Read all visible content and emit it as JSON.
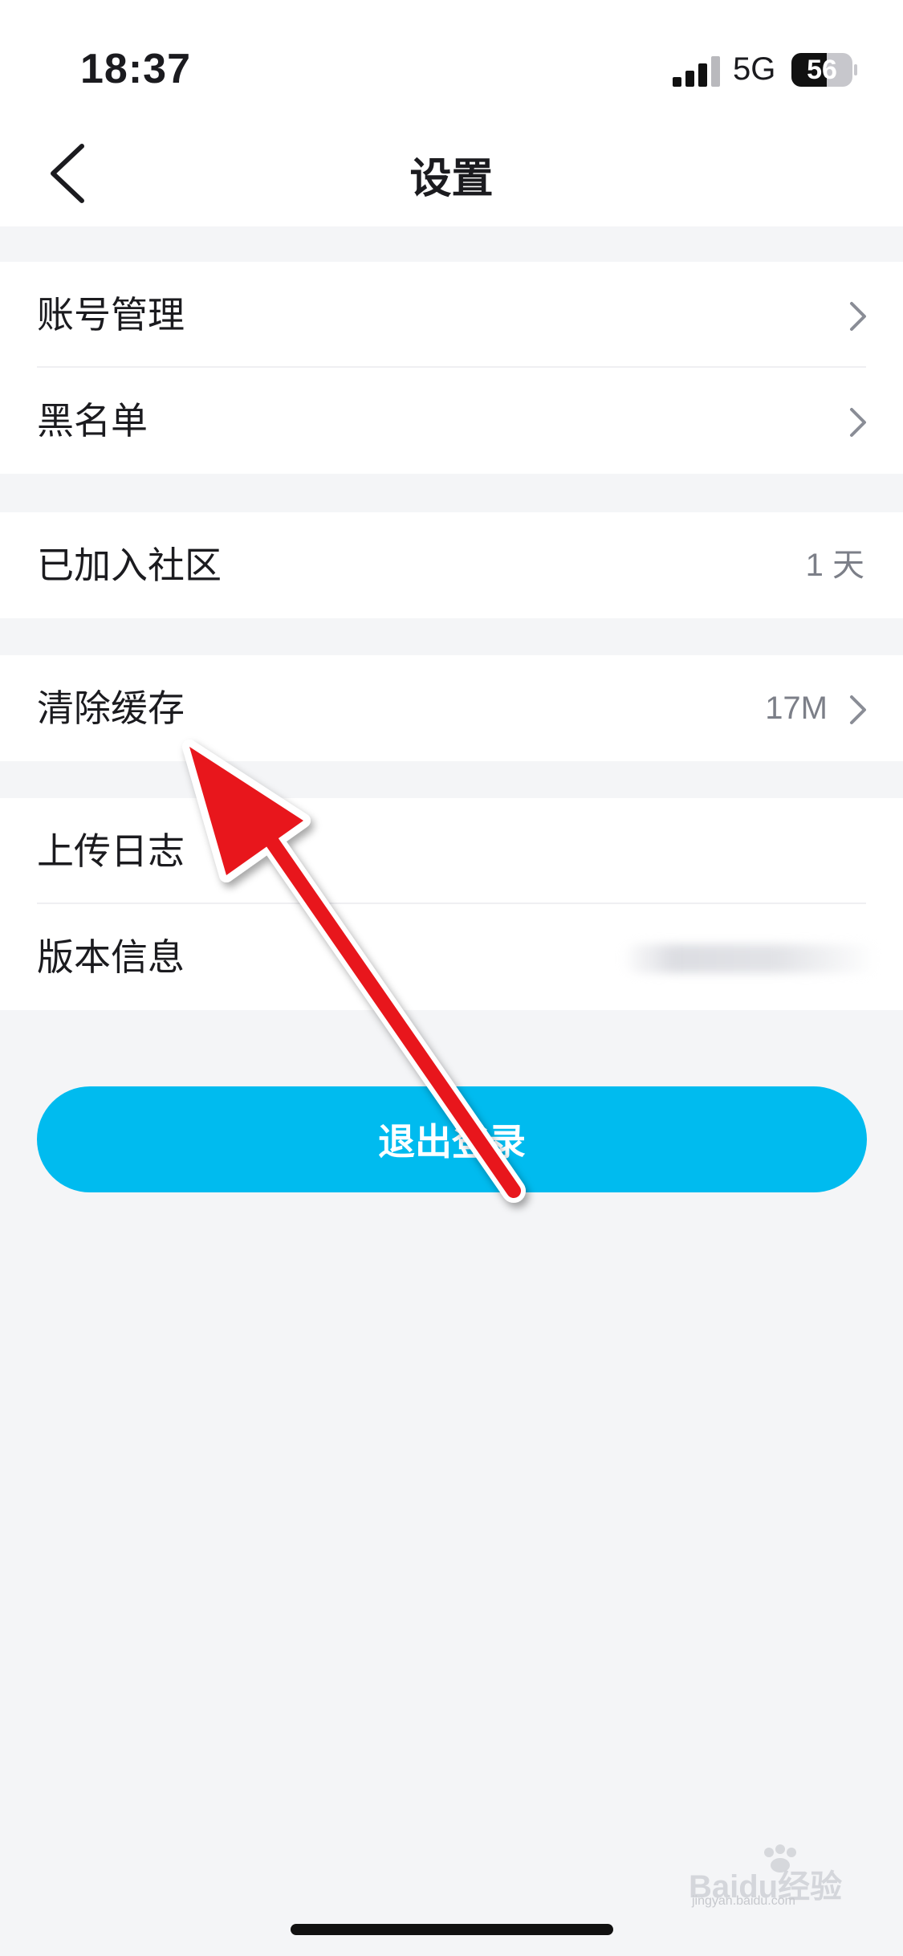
{
  "status_bar": {
    "time": "18:37",
    "network": "5G",
    "battery": "56"
  },
  "header": {
    "title": "设置"
  },
  "groups": [
    {
      "items": [
        {
          "label": "账号管理",
          "value": "",
          "chevron": true
        },
        {
          "label": "黑名单",
          "value": "",
          "chevron": true
        }
      ]
    },
    {
      "items": [
        {
          "label": "已加入社区",
          "value": "1 天",
          "chevron": false
        }
      ]
    },
    {
      "items": [
        {
          "label": "清除缓存",
          "value": "17M",
          "chevron": true
        }
      ]
    },
    {
      "items": [
        {
          "label": "上传日志",
          "value": "",
          "chevron": false
        },
        {
          "label": "版本信息",
          "value": "",
          "chevron": false
        }
      ]
    }
  ],
  "logout": {
    "label": "退出登录"
  },
  "watermark": {
    "text": "Baidu经验",
    "url": "jingyan.baidu.com"
  },
  "colors": {
    "accent": "#00bbef",
    "background": "#f4f5f7",
    "annotation_arrow": "#e8131b"
  }
}
